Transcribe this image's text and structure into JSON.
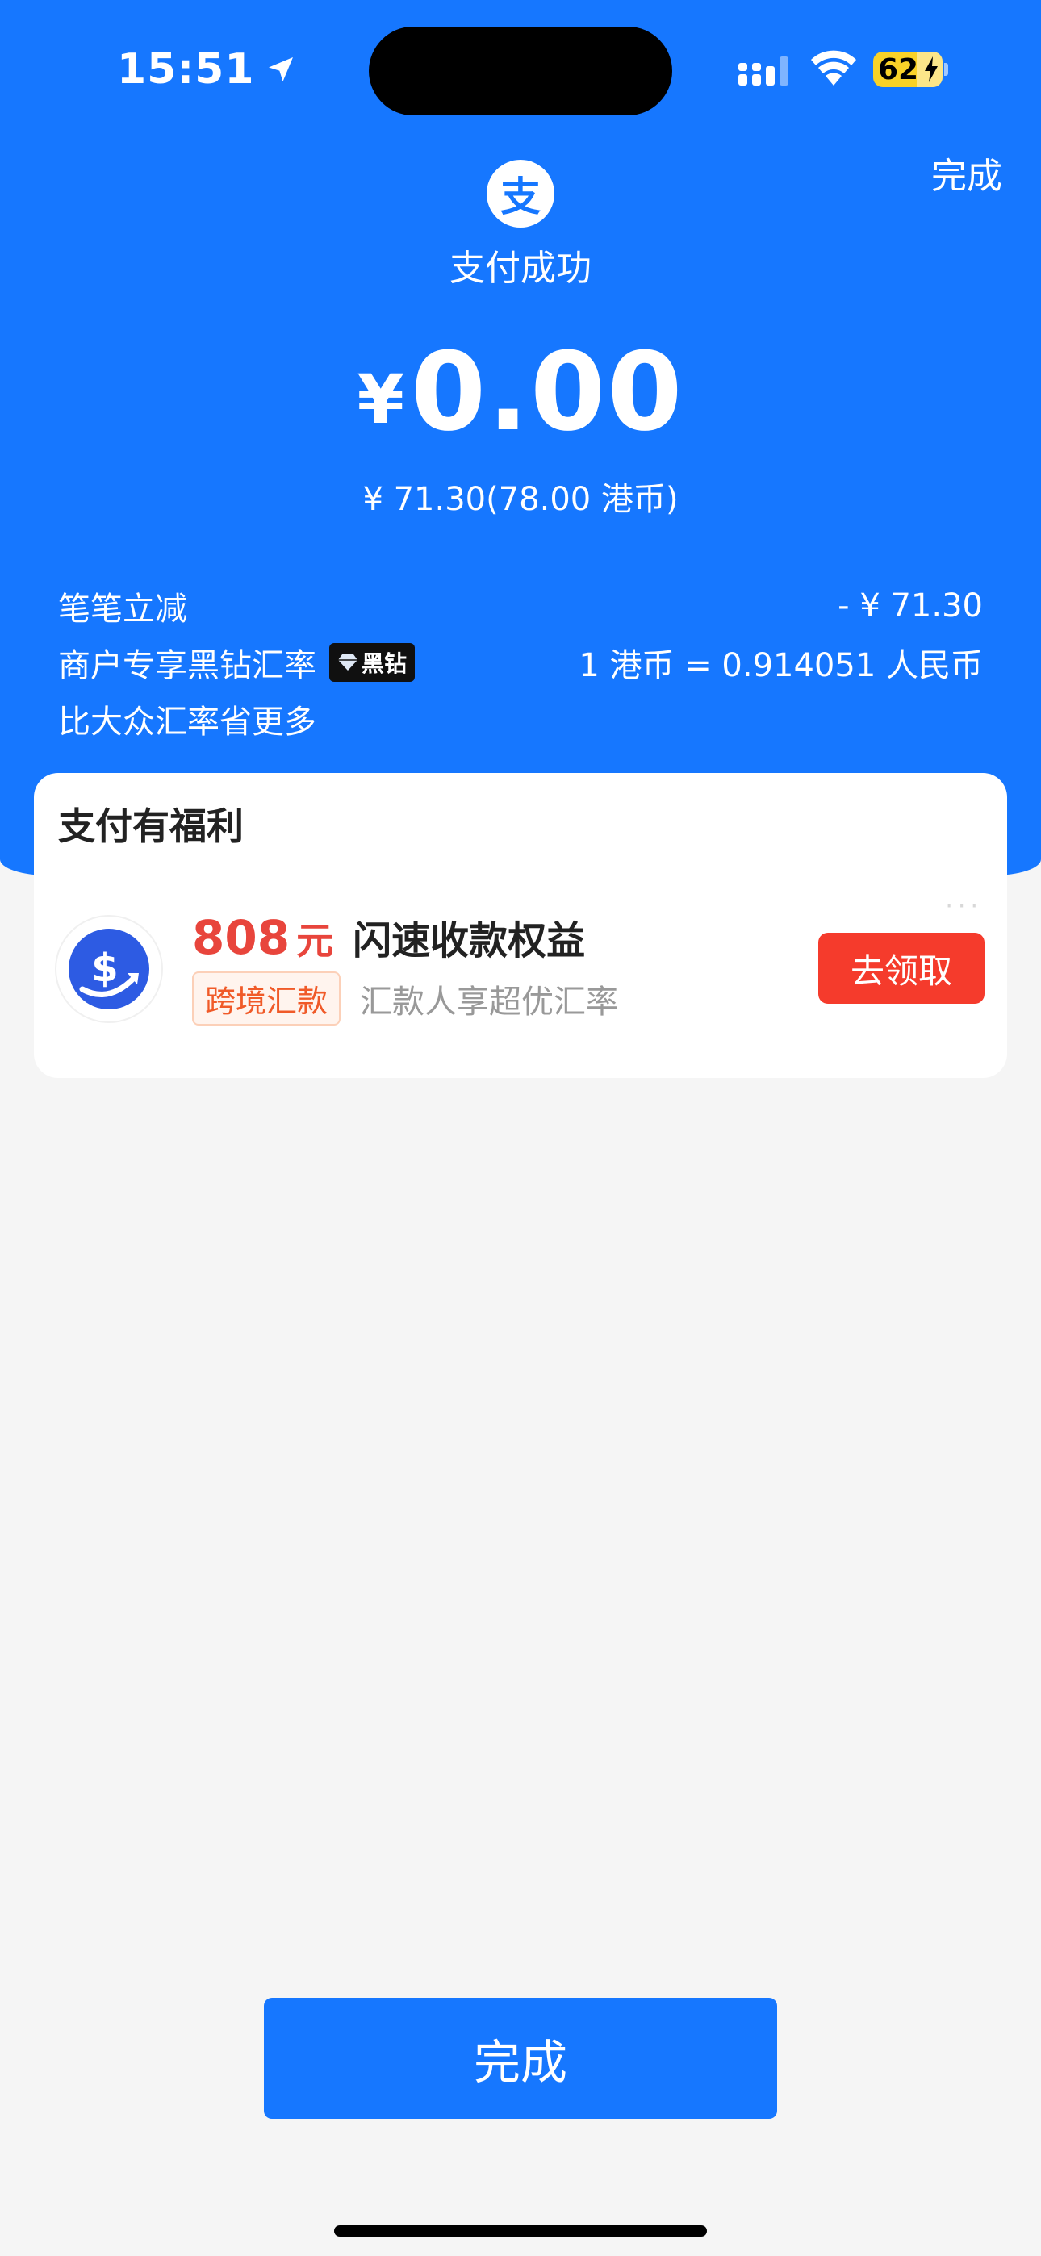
{
  "status_bar": {
    "time": "15:51",
    "battery": "62"
  },
  "header": {
    "done_label": "完成",
    "logo_char": "支",
    "title": "支付成功"
  },
  "payment": {
    "currency_symbol": "¥",
    "amount": "0.00",
    "original": "¥ 71.30(78.00 港币)"
  },
  "details": [
    {
      "label": "笔笔立减",
      "value": "- ¥ 71.30"
    },
    {
      "label": "商户专享黑钻汇率",
      "badge": "黑钻",
      "value": "1 港币 = 0.914051 人民币"
    },
    {
      "label": "比大众汇率省更多",
      "value": ""
    }
  ],
  "benefits_card": {
    "title": "支付有福利",
    "more": "···",
    "amount_number": "808",
    "amount_unit": "元",
    "benefit_title": "闪速收款权益",
    "tag": "跨境汇款",
    "description": "汇款人享超优汇率",
    "claim_label": "去领取"
  },
  "footer": {
    "done_label": "完成"
  },
  "colors": {
    "brand_blue": "#1677ff",
    "claim_red": "#f53b2c",
    "amount_red": "#e8453c"
  }
}
